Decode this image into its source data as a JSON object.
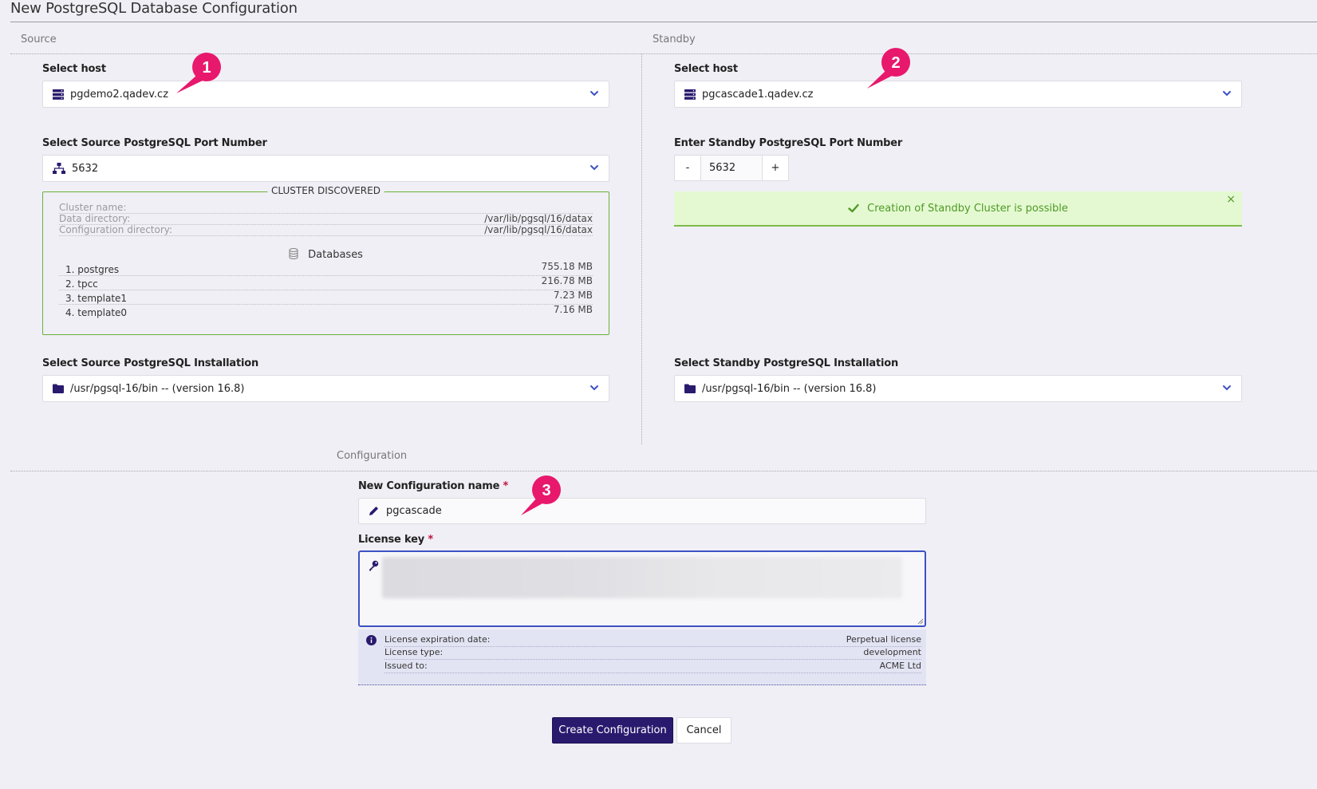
{
  "page": {
    "title": "New PostgreSQL Database Configuration"
  },
  "sections": {
    "source": "Source",
    "standby": "Standby",
    "configuration": "Configuration"
  },
  "source": {
    "host_label": "Select host",
    "host_value": "pgdemo2.qadev.cz",
    "port_label": "Select Source PostgreSQL Port Number",
    "port_value": "5632",
    "cluster": {
      "title": "CLUSTER DISCOVERED",
      "fields": [
        {
          "label": "Cluster name:",
          "value": ""
        },
        {
          "label": "Data directory:",
          "value": "/var/lib/pgsql/16/datax"
        },
        {
          "label": "Configuration directory:",
          "value": "/var/lib/pgsql/16/datax"
        }
      ],
      "databases_label": "Databases",
      "databases": [
        {
          "name": "1. postgres",
          "size": "755.18 MB"
        },
        {
          "name": "2. tpcc",
          "size": "216.78 MB"
        },
        {
          "name": "3. template1",
          "size": "7.23 MB"
        },
        {
          "name": "4. template0",
          "size": "7.16 MB"
        }
      ]
    },
    "installation_label": "Select Source PostgreSQL Installation",
    "installation_value": "/usr/pgsql-16/bin -- (version 16.8)"
  },
  "standby": {
    "host_label": "Select host",
    "host_value": "pgcascade1.qadev.cz",
    "port_label": "Enter Standby PostgreSQL Port Number",
    "port_value": "5632",
    "minus": "-",
    "plus": "+",
    "success_message": "Creation of Standby Cluster is possible",
    "close": "×",
    "installation_label": "Select Standby PostgreSQL Installation",
    "installation_value": "/usr/pgsql-16/bin -- (version 16.8)"
  },
  "configuration": {
    "name_label": "New Configuration name",
    "name_value": "pgcascade",
    "license_label": "License key",
    "required_mark": "*",
    "license_info": [
      {
        "label": "License expiration date:",
        "value": "Perpetual license"
      },
      {
        "label": "License type:",
        "value": "development"
      },
      {
        "label": "Issued to:",
        "value": "ACME Ltd"
      }
    ]
  },
  "buttons": {
    "create": "Create Configuration",
    "cancel": "Cancel"
  },
  "annotations": [
    "1",
    "2",
    "3"
  ],
  "colors": {
    "primary": "#2a1a6e",
    "accent_blue": "#3d51c4",
    "success_bg": "#e4f9d2",
    "success_text": "#4f9a25",
    "annotation_pink": "#e8186d",
    "cluster_border": "#6bb13a"
  }
}
